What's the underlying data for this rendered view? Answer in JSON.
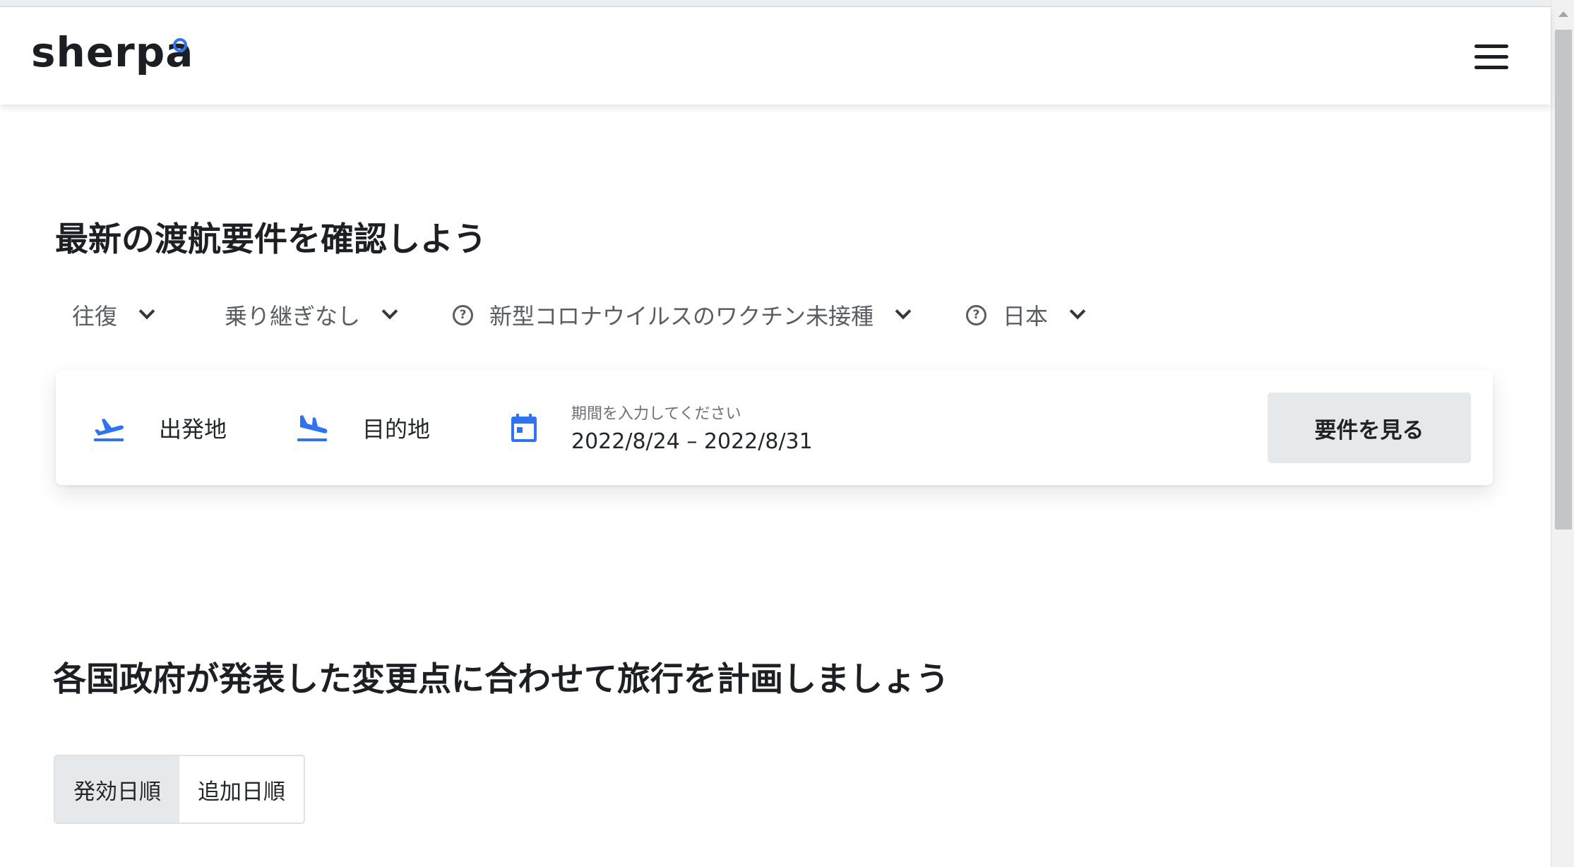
{
  "header": {
    "logo_text": "sherpa",
    "menu_icon": "hamburger-menu-icon"
  },
  "search": {
    "title": "最新の渡航要件を確認しよう",
    "filters": [
      {
        "label": "往復",
        "has_help_icon": false
      },
      {
        "label": "乗り継ぎなし",
        "has_help_icon": false
      },
      {
        "label": "新型コロナウイルスのワクチン未接種",
        "has_help_icon": true
      },
      {
        "label": "日本",
        "has_help_icon": true
      }
    ],
    "origin_label": "出発地",
    "origin_icon": "airplane-takeoff-icon",
    "destination_label": "目的地",
    "destination_icon": "airplane-landing-icon",
    "date_caption": "期間を入力してください",
    "date_value": "2022/8/24 – 2022/8/31",
    "date_icon": "calendar-icon",
    "submit_label": "要件を見る"
  },
  "changes": {
    "title": "各国政府が発表した変更点に合わせて旅行を計画しましょう",
    "sort_options": [
      {
        "label": "発効日順",
        "active": true
      },
      {
        "label": "追加日順",
        "active": false
      }
    ]
  },
  "colors": {
    "accent": "#2f73f0",
    "button_bg": "#e5e9eb",
    "text": "#1f2328"
  }
}
